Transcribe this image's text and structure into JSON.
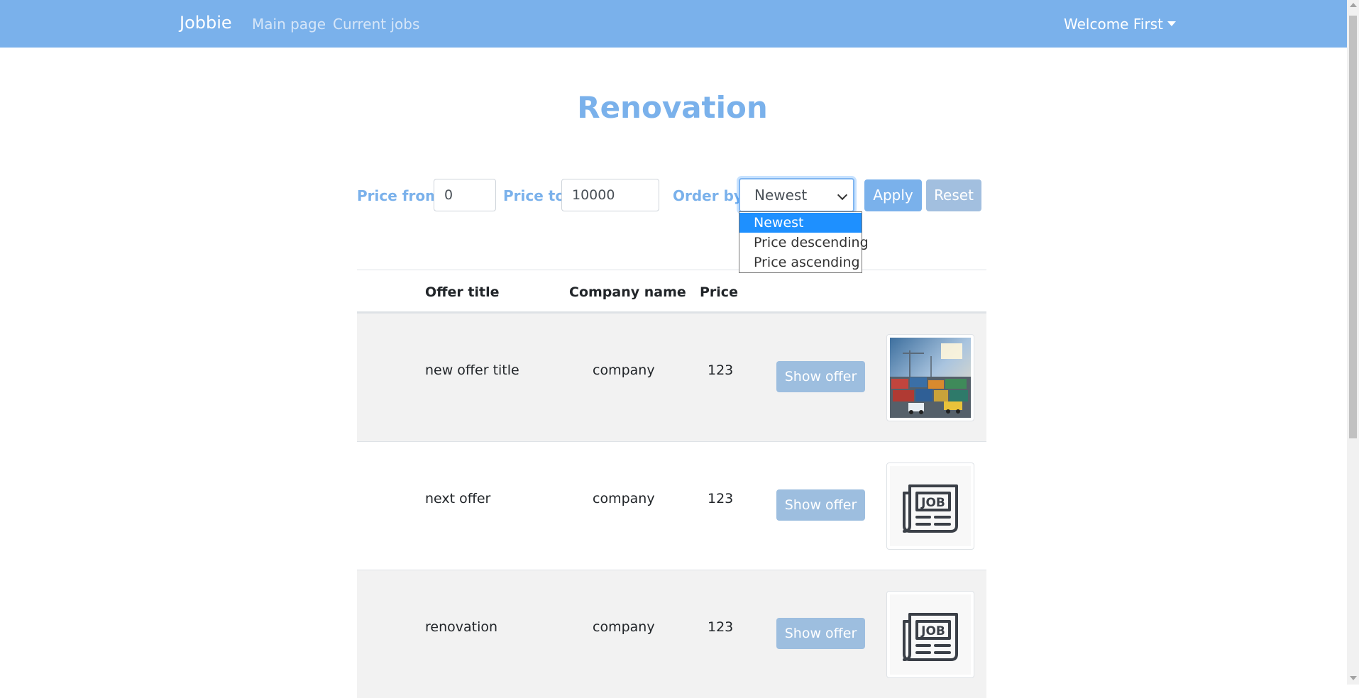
{
  "navbar": {
    "brand": "Jobbie",
    "links": [
      "Main page",
      "Current jobs"
    ],
    "user_menu": "Welcome First",
    "bg_color": "#7ab1eb"
  },
  "page": {
    "title": "Renovation"
  },
  "filters": {
    "price_from_label": "Price from:",
    "price_from_value": "0",
    "price_to_label": "Price to:",
    "price_to_value": "10000",
    "order_label": "Order by:",
    "order_selected": "Newest",
    "order_options": [
      "Newest",
      "Price descending",
      "Price ascending"
    ],
    "apply_label": "Apply",
    "reset_label": "Reset"
  },
  "table": {
    "headers": [
      "Offer title",
      "Company name",
      "Price"
    ],
    "rows": [
      {
        "title": "new offer title",
        "company": "company",
        "price": "123",
        "button": "Show offer",
        "image": "cargo-photo"
      },
      {
        "title": "next offer",
        "company": "company",
        "price": "123",
        "button": "Show offer",
        "image": "job-newspaper-icon"
      },
      {
        "title": "renovation",
        "company": "company",
        "price": "123",
        "button": "Show offer",
        "image": "job-newspaper-icon"
      }
    ]
  }
}
